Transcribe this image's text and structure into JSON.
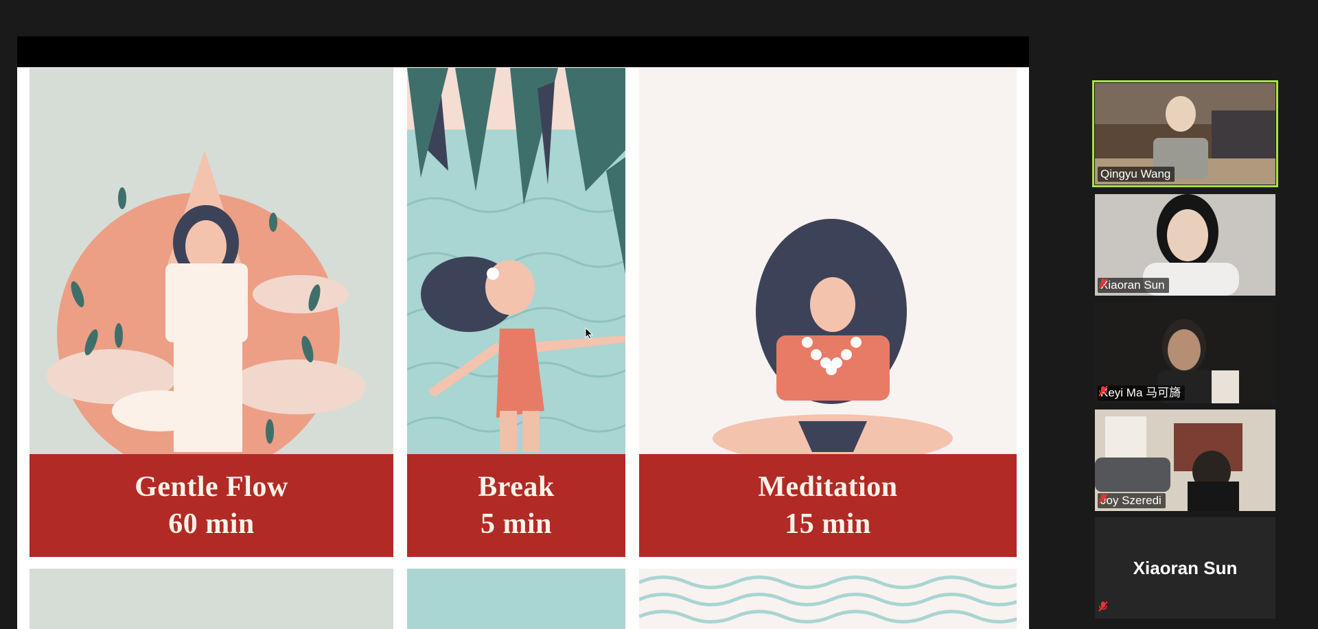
{
  "cards": [
    {
      "title": "Gentle Flow",
      "duration": "60 min"
    },
    {
      "title": "Break",
      "duration": "5 min"
    },
    {
      "title": "Meditation",
      "duration": "15 min"
    }
  ],
  "participants": [
    {
      "name": "Qingyu Wang",
      "muted": false,
      "active": true
    },
    {
      "name": "Xiaoran Sun",
      "muted": true,
      "active": false
    },
    {
      "name": "Keyi Ma 马可旖",
      "muted": true,
      "active": false
    },
    {
      "name": "Joy Szeredi",
      "muted": true,
      "active": false
    },
    {
      "name": "Xiaoran Sun",
      "muted": true,
      "active": false,
      "video_off": true
    }
  ],
  "colors": {
    "label_bg": "#b22a25",
    "label_text": "#fbf3ea",
    "active_speaker": "#a8e43a",
    "background": "#1a1a1a"
  }
}
